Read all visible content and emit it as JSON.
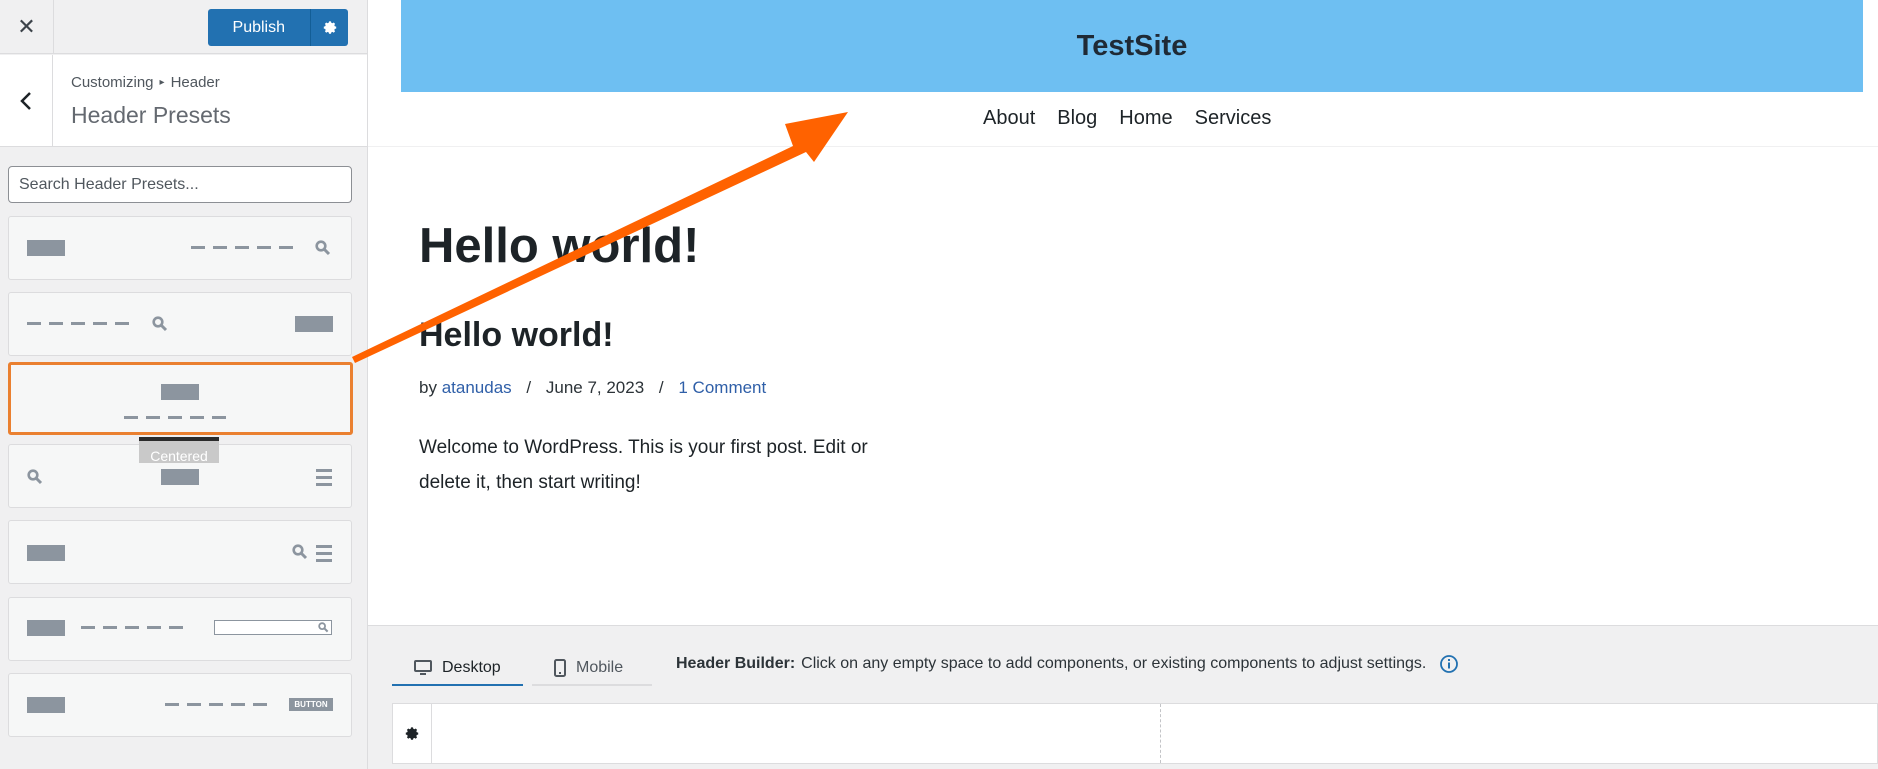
{
  "topbar": {
    "close_symbol": "✕",
    "publish_label": "Publish"
  },
  "section": {
    "breadcrumb_root": "Customizing",
    "breadcrumb_separator": "▸",
    "breadcrumb_current": "Header",
    "title": "Header Presets"
  },
  "search": {
    "placeholder": "Search Header Presets..."
  },
  "presets": {
    "selected_tooltip": "Centered",
    "button_badge": "BUTTON"
  },
  "site": {
    "title": "TestSite",
    "nav": [
      "About",
      "Blog",
      "Home",
      "Services"
    ],
    "banner_color": "#6ebff2"
  },
  "post": {
    "page_heading": "Hello world!",
    "title": "Hello world!",
    "by": "by",
    "author": "atanudas",
    "date": "June 7, 2023",
    "comments": "1 Comment",
    "excerpt": "Welcome to WordPress. This is your first post. Edit or delete it, then start writing!"
  },
  "builder": {
    "tab_desktop": "Desktop",
    "tab_mobile": "Mobile",
    "note_label": "Header Builder:",
    "note_text": "Click on any empty space to add components, or existing components to adjust settings."
  },
  "colors": {
    "accent": "#2271b1",
    "selected_outline": "#ea8030",
    "annotation_arrow": "#ff6200"
  }
}
